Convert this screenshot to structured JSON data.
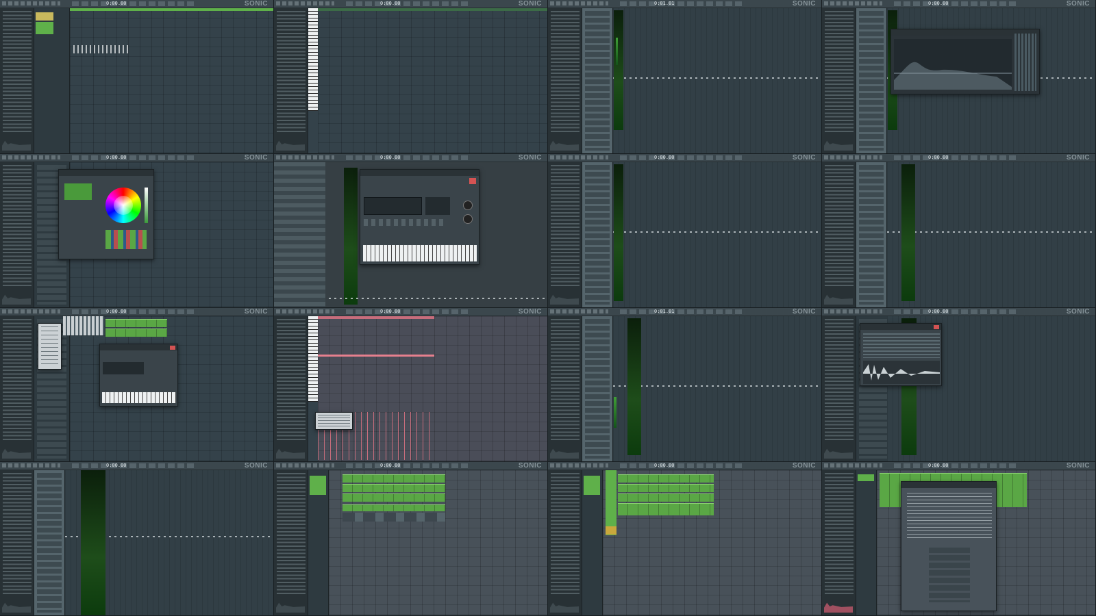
{
  "app": {
    "logo_text": "SONIC",
    "tempo_values": [
      "0:00.00",
      "0:00.00",
      "0:01.01",
      "0:00.00",
      "0:00.00",
      "0:00.00",
      "0:00.00",
      "0:00.00",
      "0:00.00",
      "0:00.00",
      "0:01.01",
      "0:00.00",
      "0:00.00",
      "0:00.00",
      "0:00.00",
      "0:00.00"
    ]
  },
  "panels": [
    {
      "view": "playlist"
    },
    {
      "view": "piano-roll"
    },
    {
      "view": "mixer"
    },
    {
      "view": "mixer-eq"
    },
    {
      "view": "color-picker"
    },
    {
      "view": "instrument-plugin"
    },
    {
      "view": "mixer"
    },
    {
      "view": "mixer"
    },
    {
      "view": "channel-rack"
    },
    {
      "view": "piano-roll"
    },
    {
      "view": "mixer"
    },
    {
      "view": "sampler"
    },
    {
      "view": "mixer"
    },
    {
      "view": "playlist"
    },
    {
      "view": "playlist"
    },
    {
      "view": "dialog"
    }
  ],
  "colors": {
    "background": "#34424a",
    "accent_green": "#5fb04a",
    "meter_green": "#1e4d1a",
    "pink": "#c76d7c"
  }
}
